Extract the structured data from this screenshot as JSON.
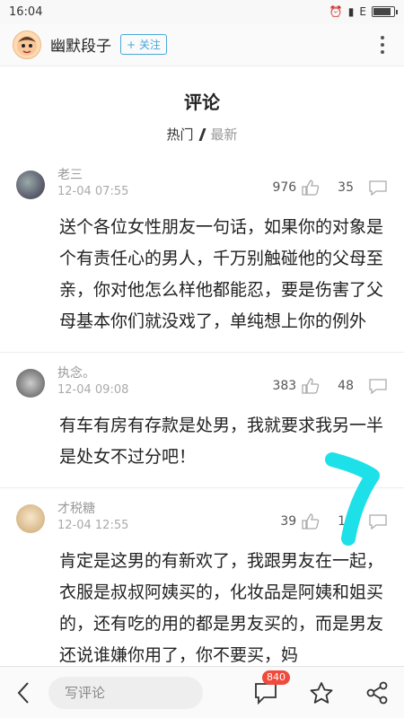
{
  "status": {
    "time": "16:04",
    "signal_text": "E"
  },
  "header": {
    "account_name": "幽默段子",
    "follow_label": "+ 关注",
    "more_icon": "more-vertical-icon"
  },
  "section": {
    "title": "评论",
    "tab_hot": "热门",
    "tab_new": "最新"
  },
  "comments": [
    {
      "user": "老三",
      "time": "12-04 07:55",
      "likes": "976",
      "replies": "35",
      "text": "送个各位女性朋友一句话，如果你的对象是个有责任心的男人，千万别触碰他的父母至亲，你对他怎么样他都能忍，要是伤害了父母基本你们就没戏了，单纯想上你的例外"
    },
    {
      "user": "执念。",
      "time": "12-04 09:08",
      "likes": "383",
      "replies": "48",
      "text": "有车有房有存款是处男，我就要求我另一半是处女不过分吧！"
    },
    {
      "user": "才税糖",
      "time": "12-04 12:55",
      "likes": "39",
      "replies": "15",
      "text": "肯定是这男的有新欢了，我跟男友在一起，衣服是叔叔阿姨买的，化妆品是阿姨和姐买的，还有吃的用的都是男友买的，而是男友还说谁嫌你用了，你不要买，妈"
    }
  ],
  "bottom": {
    "input_placeholder": "写评论",
    "comment_count": "840"
  },
  "colors": {
    "accent": "#4aa8d8",
    "badge": "#f04a3c",
    "annotation": "#1ee0e8"
  }
}
